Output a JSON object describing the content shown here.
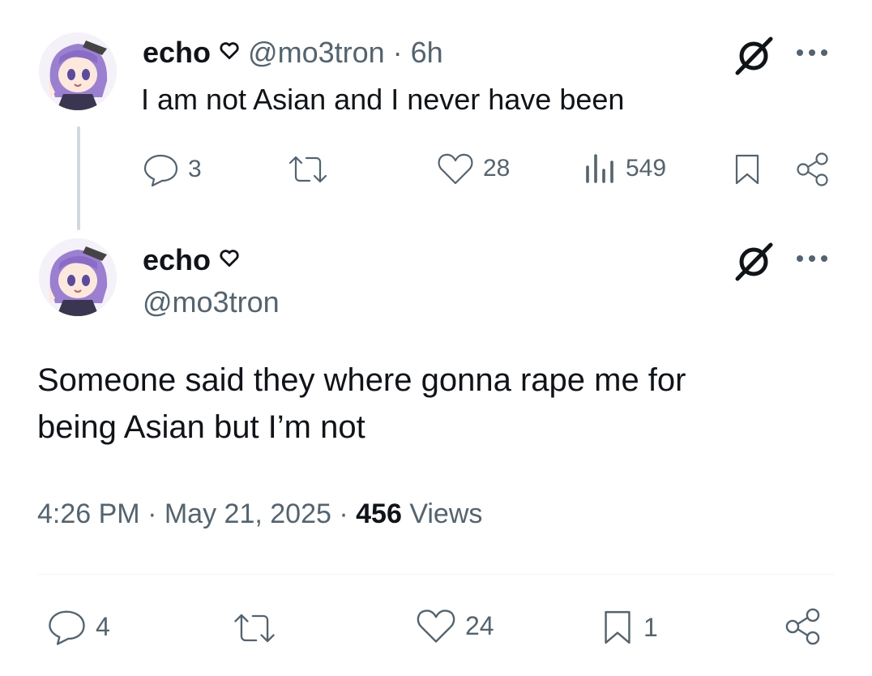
{
  "reply_tweet": {
    "author_name": "echo",
    "author_handle": "@mo3tron",
    "separator": "·",
    "time_ago": "6h",
    "text": "I am not Asian and I never have been",
    "actions": {
      "replies": "3",
      "likes": "28",
      "views": "549"
    }
  },
  "main_tweet": {
    "author_name": "echo",
    "author_handle": "@mo3tron",
    "text_line1": "Someone said they where gonna rape me for",
    "text_line2": "being Asian but I’m not",
    "time": "4:26 PM",
    "sep1": "·",
    "date": "May 21, 2025",
    "sep2": "·",
    "views_count": "456",
    "views_label": "Views",
    "actions": {
      "replies": "4",
      "likes": "24",
      "bookmarks": "1"
    }
  },
  "icons": [
    "heart-outline-icon",
    "grok-icon",
    "more-icon",
    "reply-icon",
    "retweet-icon",
    "like-icon",
    "views-icon",
    "bookmark-icon",
    "share-icon"
  ],
  "colors": {
    "text": "#0f1419",
    "muted": "#536471",
    "line": "#cfd9de",
    "avatar_hair": "#9b7fd1"
  }
}
